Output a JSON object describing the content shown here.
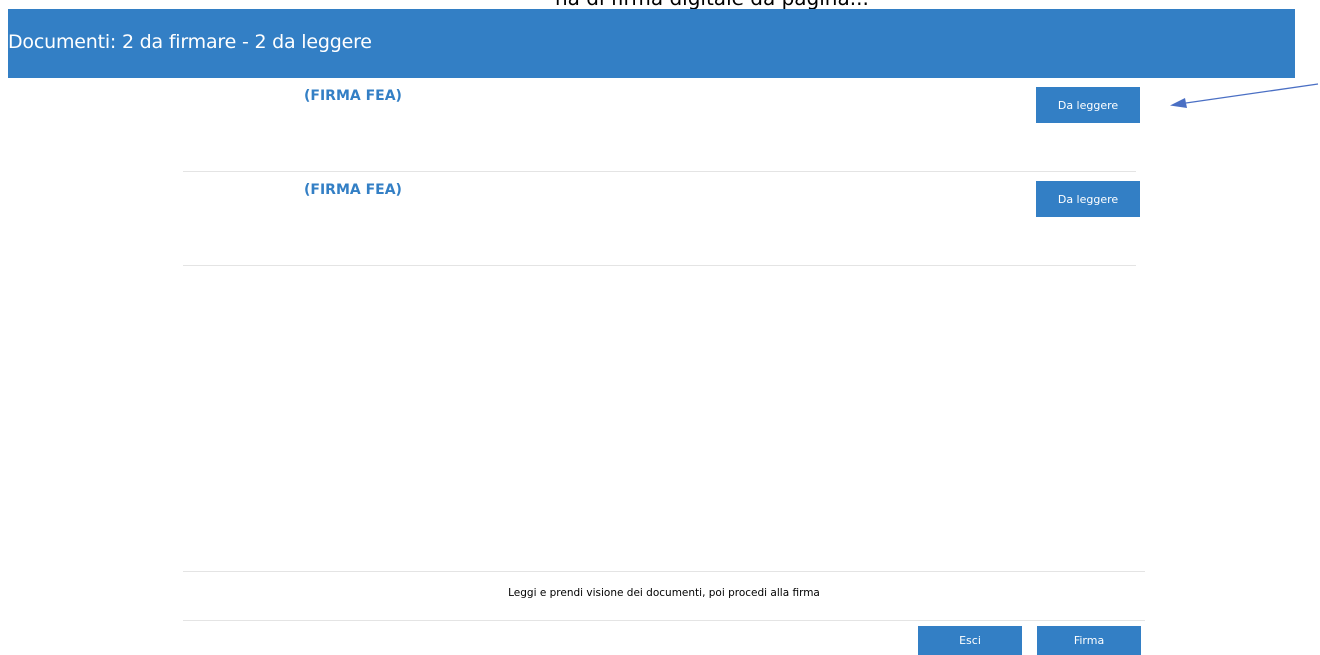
{
  "page_top_fragment": "na di firma digitale da pagina...",
  "header": {
    "title": "Documenti: 2 da firmare - 2 da leggere"
  },
  "documents": [
    {
      "title": "(FIRMA FEA)",
      "status_label": "Da leggere"
    },
    {
      "title": "(FIRMA FEA)",
      "status_label": "Da leggere"
    }
  ],
  "footer": {
    "instruction": "Leggi e prendi visione dei documenti, poi procedi alla firma",
    "exit_label": "Esci",
    "sign_label": "Firma"
  },
  "annotation": {
    "icon": "arrow-left-icon",
    "color": "#4a6fc4"
  },
  "colors": {
    "accent": "#337fc5",
    "divider": "#e4e4e4"
  }
}
